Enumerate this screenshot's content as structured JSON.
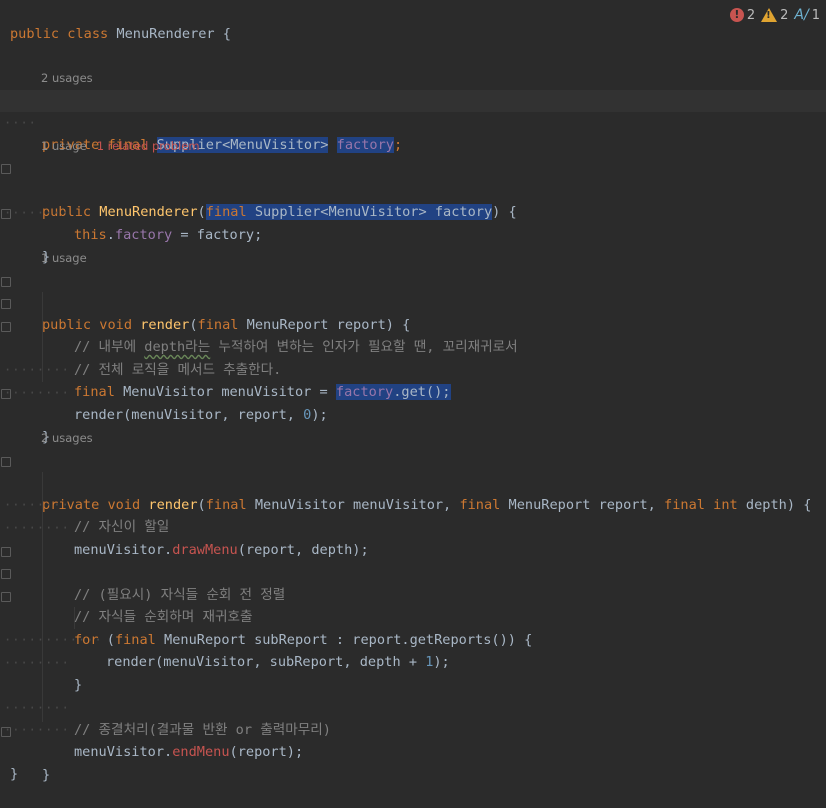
{
  "class_line": {
    "kw1": "public",
    "kw2": "class",
    "name": "MenuRenderer",
    "brace": " {"
  },
  "status": {
    "errors": "2",
    "warnings": "2",
    "typos": "1"
  },
  "hints": {
    "field_usages": "2 usages",
    "ctor_usages": "1 usage",
    "ctor_problem": "1 related problem",
    "render1_usages": "1 usage",
    "render2_usages": "2 usages"
  },
  "code": {
    "field": {
      "kw1": "private",
      "kw2": "final",
      "type": "Supplier<MenuVisitor>",
      "name": "factory",
      "end": ";"
    },
    "ctor": {
      "kw1": "public",
      "name": "MenuRenderer",
      "p_open": "(",
      "kw2": "final",
      "type": "Supplier<MenuVisitor>",
      "param": "factory",
      "p_close": ") {"
    },
    "ctor_body": {
      "this": "this",
      "dot": ".",
      "field": "factory",
      "rest": " = factory;"
    },
    "close1": "}",
    "r1": {
      "kw1": "public",
      "kw2": "void",
      "name": "render",
      "p_open": "(",
      "kw3": "final",
      "rest": " MenuReport report) {"
    },
    "r1_c1_pre": "// 내부에 ",
    "r1_c1_sq": "depth라는",
    "r1_c1_post": " 누적하여 변하는 인자가 필요할 땐, 꼬리재귀로서",
    "r1_c2": "// 전체 로직을 메서드 추출한다.",
    "r1_l3": {
      "kw": "final",
      "mid": " MenuVisitor menuVisitor = ",
      "sel_field": "factory",
      "sel_rest": ".get();"
    },
    "r1_l4": {
      "pre": "render(menuVisitor, report, ",
      "num": "0",
      "post": ");"
    },
    "close2": "}",
    "r2": {
      "kw1": "private",
      "kw2": "void",
      "name": "render",
      "p1": "(",
      "kw3": "final",
      "t1": " MenuVisitor menuVisitor, ",
      "kw4": "final",
      "t2": " MenuReport report, ",
      "kw5": "final",
      "kw6": "int",
      "t3": " depth) {"
    },
    "r2_c1": "// 자신이 할일",
    "r2_l2": {
      "pre": "menuVisitor.",
      "meth": "drawMenu",
      "post": "(report, depth);"
    },
    "r2_c2": "// (필요시) 자식들 순회 전 정렬",
    "r2_c3": "// 자식들 순회하며 재귀호출",
    "r2_for": {
      "kw1": "for",
      "p": " (",
      "kw2": "final",
      "rest": " MenuReport subReport : report.getReports()) {"
    },
    "r2_rec": {
      "pre": "render(menuVisitor, subReport, depth + ",
      "num": "1",
      "post": ");"
    },
    "close3": "}",
    "r2_c4": "// 종결처리(결과물 반환 or 출력마무리)",
    "r2_end": {
      "pre": "menuVisitor.",
      "meth": "endMenu",
      "post": "(report);"
    },
    "close4": "}",
    "close5": "}"
  }
}
